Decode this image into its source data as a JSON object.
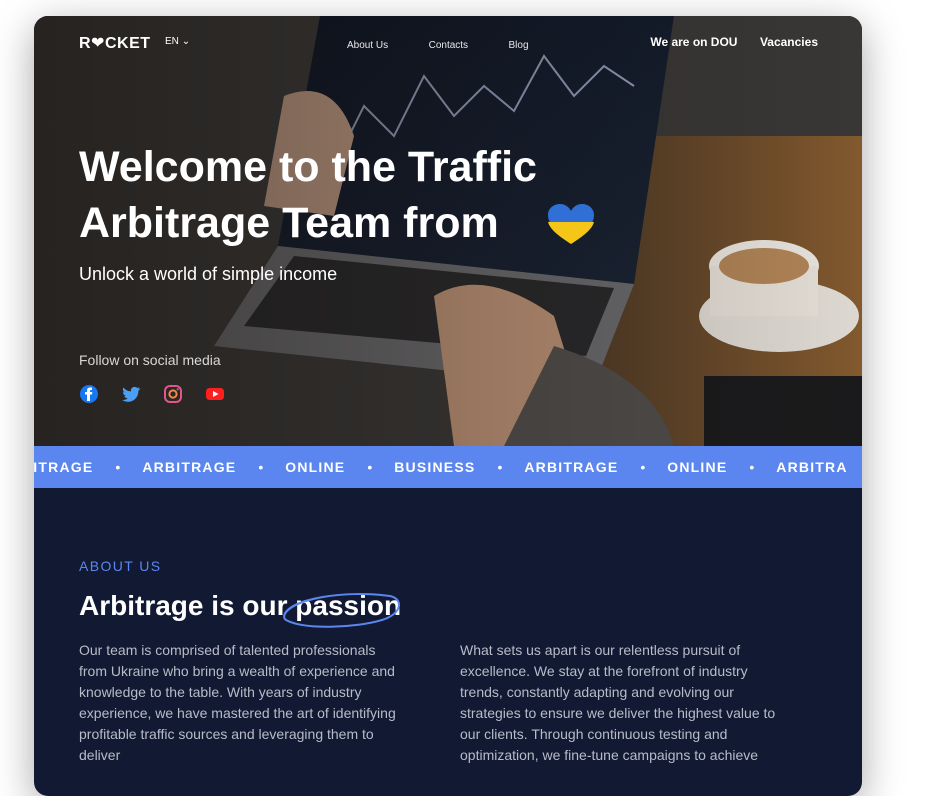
{
  "nav": {
    "logo_text": "R❤CKET",
    "lang": "EN",
    "links": [
      "About Us",
      "Contacts",
      "Blog"
    ],
    "right_links": [
      "We are on DOU",
      "Vacancies"
    ]
  },
  "hero": {
    "headline": "Welcome to the Traffic Arbitrage Team from",
    "subline": "Unlock a world of simple income",
    "follow_label": "Follow on social media",
    "socials": [
      "facebook-icon",
      "twitter-icon",
      "instagram-icon",
      "youtube-icon"
    ]
  },
  "ticker": {
    "words": [
      "BITRAGE",
      "ARBITRAGE",
      "ONLINE",
      "BUSINESS",
      "ARBITRAGE",
      "ONLINE",
      "ARBITRA"
    ]
  },
  "about": {
    "eyebrow": "ABOUT US",
    "title_plain": "Arbitrage is our",
    "title_emphasis": "passion",
    "col_left": "Our team is comprised of talented professionals from Ukraine who bring a wealth of experience and knowledge to the table. With years of industry experience, we have mastered the art of identifying profitable traffic sources and leveraging them to deliver",
    "col_right": "What sets us apart is our relentless pursuit of excellence. We stay at the forefront of industry trends, constantly adapting and evolving our strategies to ensure we deliver the highest value to our clients. Through continuous testing and optimization, we fine-tune campaigns to achieve"
  },
  "colors": {
    "accent": "#5b86ef",
    "page_bg": "#121a33",
    "flag_blue": "#2f6fd6",
    "flag_yellow": "#f5c518"
  }
}
